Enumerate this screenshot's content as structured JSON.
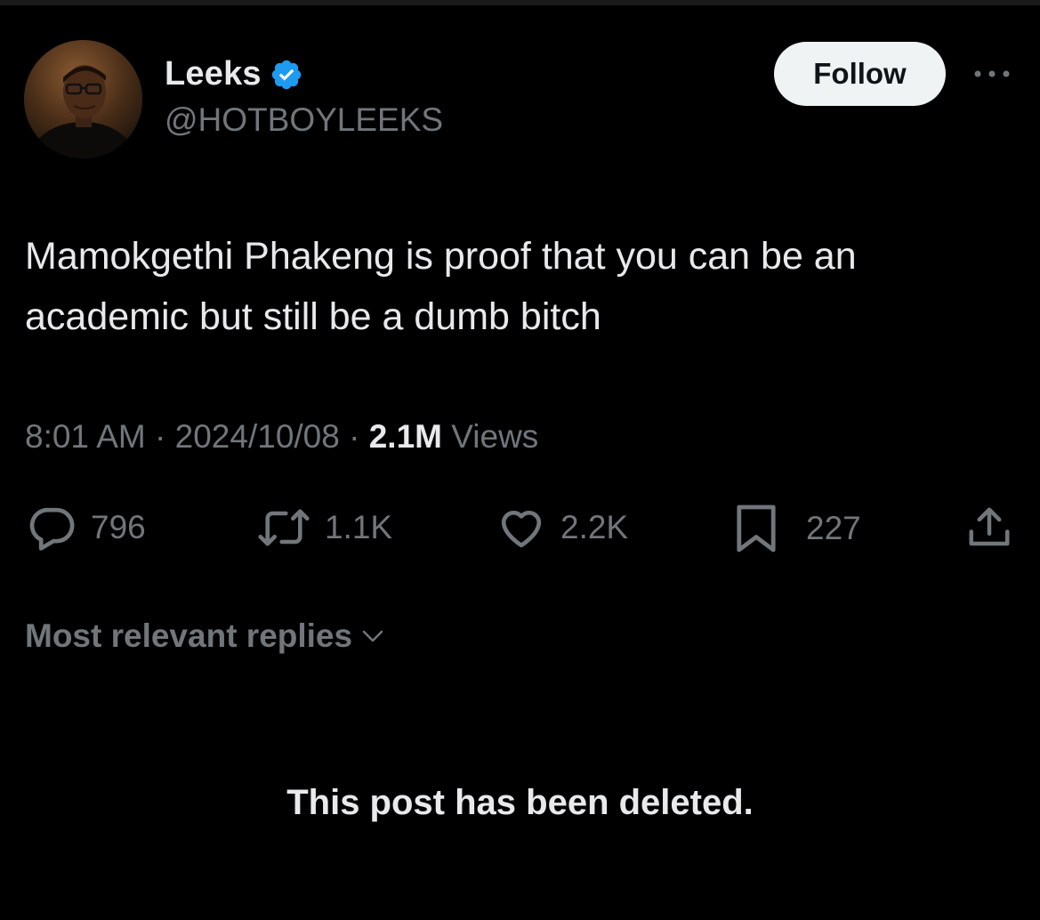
{
  "author": {
    "display_name": "Leeks",
    "handle": "@HOTBOYLEEKS",
    "verified_icon": "verified-badge-icon",
    "verified_color": "#1d9bf0"
  },
  "follow_button": {
    "label": "Follow"
  },
  "more_menu_icon": "more-dots-icon",
  "tweet": {
    "text": "Mamokgethi Phakeng is proof that you can be an academic but still be a dumb bitch",
    "time": "8:01 AM",
    "separator": "·",
    "date": "2024/10/08",
    "views_count": "2.1M",
    "views_label": "Views"
  },
  "actions": {
    "replies": {
      "icon": "reply-icon",
      "count": "796"
    },
    "reposts": {
      "icon": "repost-icon",
      "count": "1.1K"
    },
    "likes": {
      "icon": "heart-icon",
      "count": "2.2K"
    },
    "bookmarks": {
      "icon": "bookmark-icon",
      "count": "227"
    },
    "share": {
      "icon": "share-icon"
    }
  },
  "replies_sort": {
    "label": "Most relevant replies",
    "icon": "chevron-down-icon"
  },
  "deleted_notice": "This post has been deleted.",
  "colors": {
    "background": "#000000",
    "primary_text": "#e7e9ea",
    "secondary_text": "#71767b",
    "follow_button_bg": "#eff3f4"
  }
}
